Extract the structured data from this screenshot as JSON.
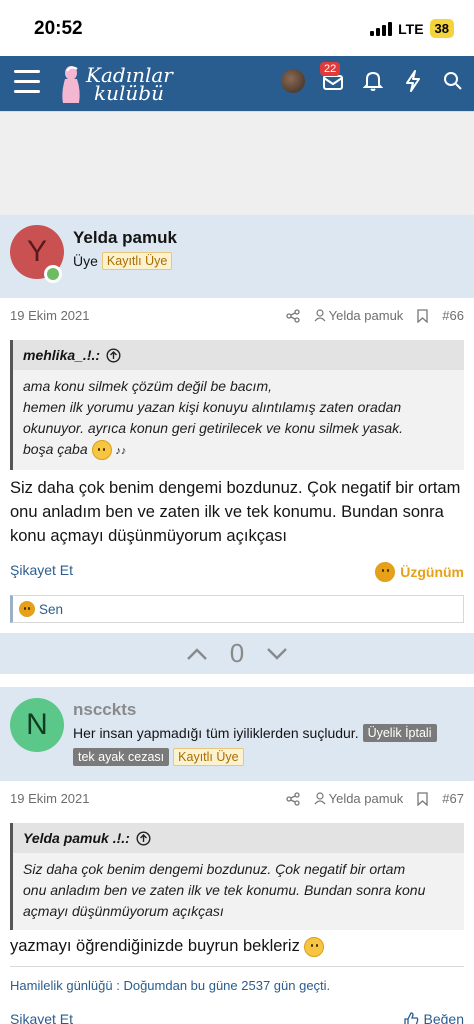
{
  "status_bar": {
    "time": "20:52",
    "network": "LTE",
    "battery": "38"
  },
  "navbar": {
    "logo_line1": "Kadınlar",
    "logo_line2": "kulübü",
    "notification_count": "22"
  },
  "posts": [
    {
      "avatar_letter": "Y",
      "avatar_color": "#c95151",
      "username": "Yelda pamuk",
      "user_title": "Üye",
      "user_badge": "Kayıtlı Üye",
      "date": "19 Ekim 2021",
      "author_link": "Yelda pamuk",
      "post_number": "#66",
      "quote": {
        "author": "mehlika_.!.:",
        "lines": [
          "ama konu silmek çözüm değil be bacım,",
          "hemen ilk yorumu yazan kişi konuyu alıntılamış zaten oradan",
          "okunuyor. ayrıca konun geri getirilecek ve konu silmek yasak.",
          "boşa çaba"
        ]
      },
      "text": "Siz daha çok benim dengemi bozdunuz. Çok negatif bir ortam onu anladım ben ve zaten ilk ve tek konumu. Bundan sonra konu açmayı düşünmüyorum açıkçası",
      "report_label": "Şikayet Et",
      "reaction_label": "Üzgünüm",
      "reactions_by": "Sen",
      "vote_count": "0"
    },
    {
      "avatar_letter": "N",
      "avatar_color": "#5bc88a",
      "username": "nscckts",
      "user_title": "Her insan yapmadığı tüm iyiliklerden suçludur.",
      "user_badges": [
        "Üyelik İptali",
        "tek ayak cezası",
        "Kayıtlı Üye"
      ],
      "date": "19 Ekim 2021",
      "author_link": "Yelda pamuk",
      "post_number": "#67",
      "quote": {
        "author": "Yelda pamuk .!.:",
        "lines": [
          "Siz daha çok benim dengemi bozdunuz. Çok negatif bir ortam",
          "onu anladım ben ve zaten ilk ve tek konumu. Bundan sonra konu",
          "açmayı düşünmüyorum açıkçası"
        ]
      },
      "text": "yazmayı öğrendiğinizde buyrun bekleriz",
      "signature": "Hamilelik günlüğü : Doğumdan bu güne 2537 gün geçti.",
      "report_label": "Şikayet Et",
      "like_label": "Beğen"
    }
  ]
}
